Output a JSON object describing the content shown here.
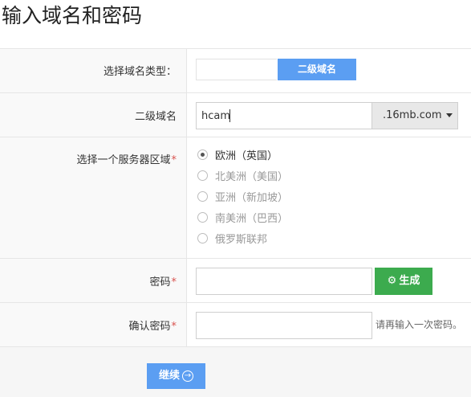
{
  "page": {
    "title": "输入域名和密码"
  },
  "fields": {
    "domain_type": {
      "label": "选择域名类型：",
      "active_option": "二级域名"
    },
    "subdomain": {
      "label": "二级域名",
      "value": "hcam",
      "suffix": ".16mb.com"
    },
    "region": {
      "label": "选择一个服务器区域",
      "required": "*",
      "options": [
        {
          "label": "欧洲（英国）",
          "checked": true
        },
        {
          "label": "北美洲（美国）",
          "checked": false
        },
        {
          "label": "亚洲（新加坡）",
          "checked": false
        },
        {
          "label": "南美洲（巴西）",
          "checked": false
        },
        {
          "label": "俄罗斯联邦",
          "checked": false
        }
      ]
    },
    "password": {
      "label": "密码",
      "required": "*",
      "value": "",
      "generate_label": "生成"
    },
    "confirm_password": {
      "label": "确认密码",
      "required": "*",
      "value": "",
      "hint": "请再输入一次密码。"
    }
  },
  "footer": {
    "continue_label": "继续"
  },
  "colors": {
    "accent": "#5b9ef2",
    "generate": "#3cab4e",
    "required": "#d9534f"
  }
}
